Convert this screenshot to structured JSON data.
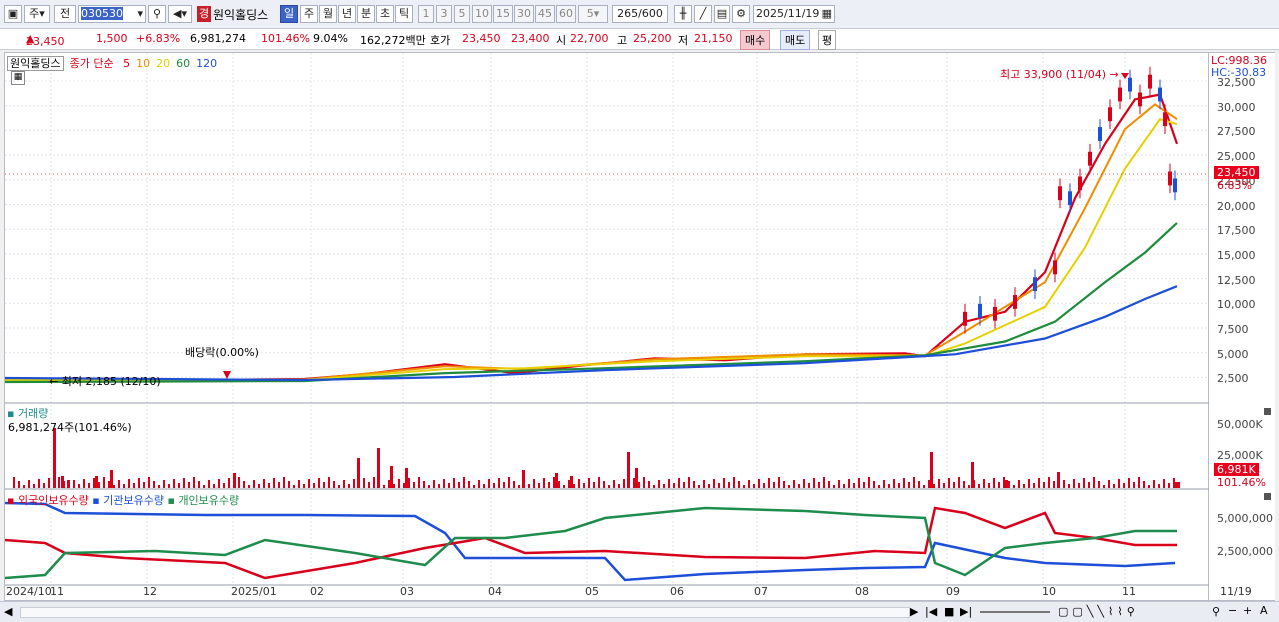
{
  "toolbar": {
    "period_unit": "주",
    "prev_label": "전",
    "stock_code": "030530",
    "grade_badge": "경",
    "stock_name": "원익홀딩스",
    "intervals": [
      "일",
      "주",
      "월",
      "년",
      "분",
      "초",
      "틱"
    ],
    "active_interval": "일",
    "minute_values": [
      "1",
      "3",
      "5",
      "10",
      "15",
      "30",
      "45",
      "60"
    ],
    "period_select": "5",
    "count_display": "265",
    "count_total": "/600",
    "date": "2025/11/19"
  },
  "info": {
    "price": "23,450",
    "change": "1,500",
    "change_pct": "+6.83%",
    "volume": "6,981,274",
    "volume_ratio": "101.46%",
    "turnover": "9.04%",
    "amount": "162,272백만",
    "bid_label": "호가",
    "ask1": "23,450",
    "bid1": "23,400",
    "open_label": "시",
    "open": "22,700",
    "high_label": "고",
    "high": "25,200",
    "low_label": "저",
    "low": "21,150",
    "buy_label": "매수",
    "sell_label": "매도",
    "avg_label": "평"
  },
  "price_panel": {
    "name_tag": "원익홀딩스",
    "legend_prefix": "종가 단순",
    "ma_periods": [
      "5",
      "10",
      "20",
      "60",
      "120"
    ],
    "ma_colors": [
      "#d9001b",
      "#f08c00",
      "#e6d000",
      "#1e8c3c",
      "#1d4fd8"
    ],
    "lc": "LC:998.36",
    "hc": "HC:-30.83",
    "high_note": "최고 33,900 (11/04)",
    "low_note": "최저 2,185 (12/10)",
    "dividend_note": "배당락(0.00%)",
    "price_tag": "23,450",
    "pct_tag": "6.83%",
    "y_ticks": [
      "32,500",
      "30,000",
      "27,500",
      "25,000",
      "22,500",
      "20,000",
      "17,500",
      "15,000",
      "12,500",
      "10,000",
      "7,500",
      "5,000",
      "2,500"
    ]
  },
  "volume_panel": {
    "title": "거래량",
    "value": "6,981,274주(101.46%)",
    "y_ticks": [
      "50,000K",
      "25,000K"
    ],
    "tag": "6,981K",
    "tag_pct": "101.46%"
  },
  "holdings_panel": {
    "foreign": "외국인보유수량",
    "institution": "기관보유수량",
    "individual": "개인보유수량",
    "y_ticks": [
      "5,000,000",
      "2,500,000"
    ]
  },
  "x_axis": [
    "2024/10",
    "11",
    "12",
    "2025/01",
    "02",
    "03",
    "04",
    "05",
    "06",
    "07",
    "08",
    "09",
    "10",
    "11",
    "11/19"
  ]
}
